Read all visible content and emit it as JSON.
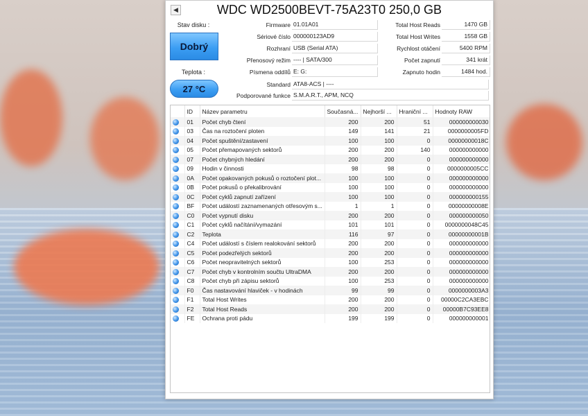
{
  "window": {
    "title": "WDC WD2500BEVT-75A23T0 250,0 GB"
  },
  "status": {
    "label": "Stav disku :",
    "value": "Dobrý"
  },
  "temperature": {
    "label": "Teplota :",
    "value": "27 °C"
  },
  "info_left": [
    {
      "label": "Firmware",
      "value": "01.01A01"
    },
    {
      "label": "Sériové číslo",
      "value": "000000123AD9"
    },
    {
      "label": "Rozhraní",
      "value": "USB (Serial ATA)"
    },
    {
      "label": "Přenosový režim",
      "value": "---- | SATA/300"
    },
    {
      "label": "Písmena oddílů",
      "value": "E: G:"
    },
    {
      "label": "Standard",
      "value": "ATA8-ACS | ----"
    },
    {
      "label": "Podporované funkce",
      "value": "S.M.A.R.T., APM, NCQ"
    }
  ],
  "info_right": [
    {
      "label": "Total Host Reads",
      "value": "1470 GB"
    },
    {
      "label": "Total Host Writes",
      "value": "1558 GB"
    },
    {
      "label": "Rychlost otáčení",
      "value": "5400 RPM"
    },
    {
      "label": "Počet zapnutí",
      "value": "341 krát"
    },
    {
      "label": "Zapnuto hodin",
      "value": "1484 hod."
    }
  ],
  "table": {
    "headers": [
      "",
      "ID",
      "Název parametru",
      "Současná...",
      "Nejhorší ...",
      "Hraniční ...",
      "Hodnoty RAW"
    ],
    "rows": [
      [
        "01",
        "Počet chyb čtení",
        "200",
        "200",
        "51",
        "000000000030"
      ],
      [
        "03",
        "Čas na roztočení ploten",
        "149",
        "141",
        "21",
        "0000000005FD"
      ],
      [
        "04",
        "Počet spuštění/zastavení",
        "100",
        "100",
        "0",
        "00000000018C"
      ],
      [
        "05",
        "Počet přemapovaných sektorů",
        "200",
        "200",
        "140",
        "000000000000"
      ],
      [
        "07",
        "Počet chybných hledání",
        "200",
        "200",
        "0",
        "000000000000"
      ],
      [
        "09",
        "Hodin v činnosti",
        "98",
        "98",
        "0",
        "0000000005CC"
      ],
      [
        "0A",
        "Počet opakovaných pokusů o roztočení plot...",
        "100",
        "100",
        "0",
        "000000000000"
      ],
      [
        "0B",
        "Počet pokusů o překalibrování",
        "100",
        "100",
        "0",
        "000000000000"
      ],
      [
        "0C",
        "Počet cyklů zapnutí zařízení",
        "100",
        "100",
        "0",
        "000000000155"
      ],
      [
        "BF",
        "Počet událostí zaznamenaných otřesovým s...",
        "1",
        "1",
        "0",
        "00000000008E"
      ],
      [
        "C0",
        "Počet vypnutí disku",
        "200",
        "200",
        "0",
        "000000000050"
      ],
      [
        "C1",
        "Počet cyklů načítání/vymazání",
        "101",
        "101",
        "0",
        "0000000048C45"
      ],
      [
        "C2",
        "Teplota",
        "116",
        "97",
        "0",
        "00000000001B"
      ],
      [
        "C4",
        "Počet událostí s číslem realokování sektorů",
        "200",
        "200",
        "0",
        "000000000000"
      ],
      [
        "C5",
        "Počet podezřelých sektorů",
        "200",
        "200",
        "0",
        "000000000000"
      ],
      [
        "C6",
        "Počet neopravitelných sektorů",
        "100",
        "253",
        "0",
        "000000000000"
      ],
      [
        "C7",
        "Počet chyb v kontrolním součtu UltraDMA",
        "200",
        "200",
        "0",
        "000000000000"
      ],
      [
        "C8",
        "Počet chyb při zápisu sektorů",
        "100",
        "253",
        "0",
        "000000000000"
      ],
      [
        "F0",
        "Čas nastavování hlaviček - v hodinách",
        "99",
        "99",
        "0",
        "0000000003A3"
      ],
      [
        "F1",
        "Total Host Writes",
        "200",
        "200",
        "0",
        "00000C2CA3EBC"
      ],
      [
        "F2",
        "Total Host Reads",
        "200",
        "200",
        "0",
        "00000B7C93EE8"
      ],
      [
        "FE",
        "Ochrana proti pádu",
        "199",
        "199",
        "0",
        "000000000001"
      ]
    ]
  }
}
